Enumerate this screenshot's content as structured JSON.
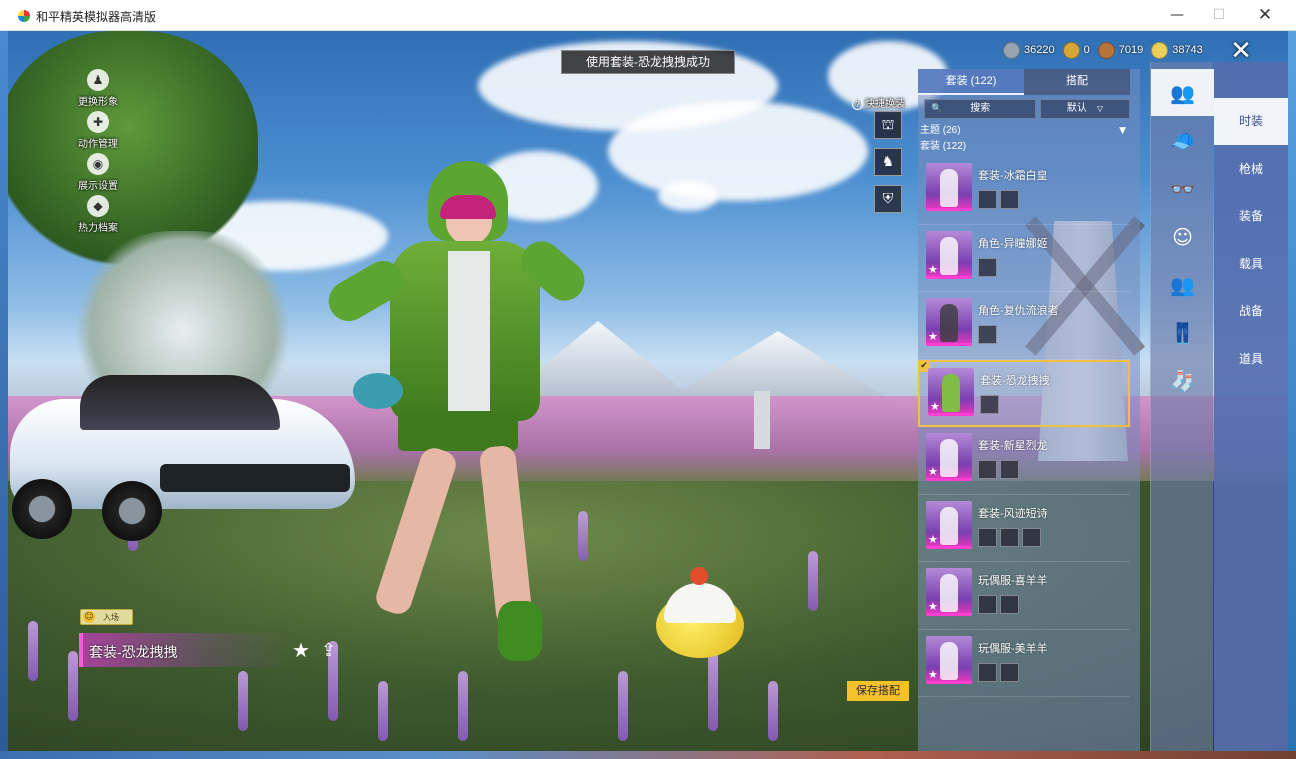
{
  "window": {
    "title": "和平精英模拟器高清版",
    "minimize": "—",
    "maximize": "☐",
    "close": "✕"
  },
  "toast": "使用套装-恐龙拽拽成功",
  "left_menu": [
    {
      "label": "更换形象",
      "icon": "person-icon",
      "glyph": "♟"
    },
    {
      "label": "动作管理",
      "icon": "puzzle-icon",
      "glyph": "✚"
    },
    {
      "label": "展示设置",
      "icon": "eye-icon",
      "glyph": "◉"
    },
    {
      "label": "热力档案",
      "icon": "profile-icon",
      "glyph": "◆"
    }
  ],
  "currencies": [
    {
      "value": "36220",
      "icon": "coin-silver-icon",
      "color": "#9aa4b0"
    },
    {
      "value": "0",
      "icon": "coin-gold-icon",
      "color": "#d7a63a"
    },
    {
      "value": "7019",
      "icon": "coin-bronze-icon",
      "color": "#b8743a"
    },
    {
      "value": "38743",
      "icon": "diamond-icon",
      "color": "#e8d05a"
    }
  ],
  "close_game": "✕",
  "quick_swap": {
    "label": "快捷换装",
    "help": "?",
    "buttons": [
      {
        "icon": "hanger-icon",
        "glyph": "⛫"
      },
      {
        "icon": "character-icon",
        "glyph": "♞"
      },
      {
        "icon": "shield-icon",
        "glyph": "⛨"
      }
    ]
  },
  "panel": {
    "tabs": [
      {
        "label": "套装 (122)",
        "active": true
      },
      {
        "label": "搭配",
        "active": false
      }
    ],
    "search_placeholder": "搜索",
    "search_icon": "🔍",
    "sort": "默认",
    "sort_arrow": "▽",
    "theme_row": "主题 (26)",
    "theme_arrow": "▼",
    "suit_row": "套装 (122)",
    "outfits": [
      {
        "name": "套装-冰霜白皇",
        "pieces": 2,
        "selected": false
      },
      {
        "name": "角色-异瞳娜姬",
        "pieces": 1,
        "selected": false
      },
      {
        "name": "角色-复仇流浪者",
        "pieces": 1,
        "selected": false
      },
      {
        "name": "套装-恐龙拽拽",
        "pieces": 1,
        "selected": true
      },
      {
        "name": "套装-新星烈龙",
        "pieces": 2,
        "selected": false
      },
      {
        "name": "套装-风迹短诗",
        "pieces": 3,
        "selected": false
      },
      {
        "name": "玩偶服-喜羊羊",
        "pieces": 2,
        "selected": false
      },
      {
        "name": "玩偶服-美羊羊",
        "pieces": 2,
        "selected": false
      }
    ],
    "star": "★",
    "check": "✔"
  },
  "category_icons": [
    {
      "icon": "outfit-icon",
      "glyph": "👥",
      "active": true
    },
    {
      "icon": "cap-icon",
      "glyph": "🧢",
      "active": false
    },
    {
      "icon": "glasses-icon",
      "glyph": "👓",
      "active": false
    },
    {
      "icon": "mask-icon",
      "glyph": "☺",
      "active": false
    },
    {
      "icon": "suit-icon",
      "glyph": "👥",
      "active": false
    },
    {
      "icon": "pants-icon",
      "glyph": "👖",
      "active": false
    },
    {
      "icon": "socks-icon",
      "glyph": "🧦",
      "active": false
    }
  ],
  "category_labels": [
    {
      "label": "时装",
      "active": true
    },
    {
      "label": "枪械",
      "active": false
    },
    {
      "label": "装备",
      "active": false
    },
    {
      "label": "载具",
      "active": false
    },
    {
      "label": "战备",
      "active": false
    },
    {
      "label": "道具",
      "active": false
    }
  ],
  "entry_tag": {
    "label": "入场",
    "icon": "☺"
  },
  "current_outfit": "套装-恐龙拽拽",
  "favorite": "★",
  "share": "⇪",
  "save_button": "保存搭配"
}
